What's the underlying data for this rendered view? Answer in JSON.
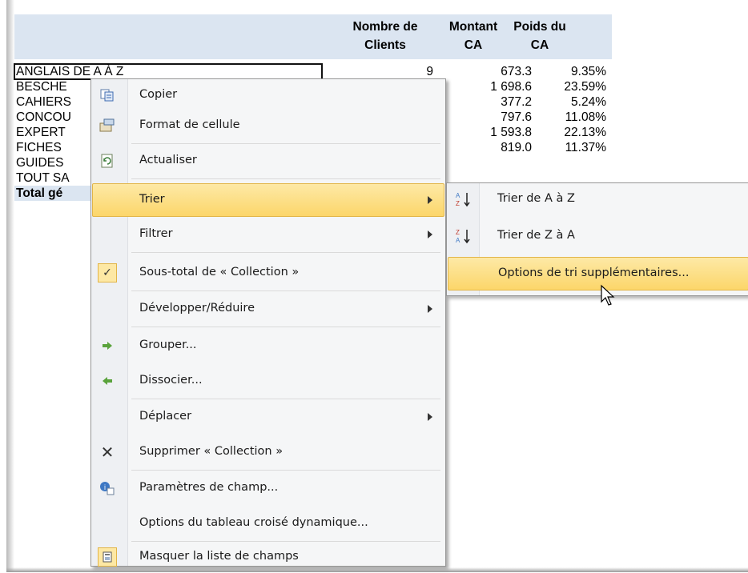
{
  "pivot": {
    "headers": {
      "clients": "Nombre de\nClients",
      "montant": "Montant\nCA",
      "poids": "Poids du\nCA"
    },
    "rows": [
      {
        "label": "ANGLAIS DE A À Z",
        "clients": "9",
        "montant": "673.3",
        "poids": "9.35%"
      },
      {
        "label": "BESCHE",
        "clients": "",
        "montant": "1 698.6",
        "poids": "23.59%"
      },
      {
        "label": "CAHIERS",
        "clients": "",
        "montant": "377.2",
        "poids": "5.24%"
      },
      {
        "label": "CONCOU",
        "clients": "",
        "montant": "797.6",
        "poids": "11.08%"
      },
      {
        "label": "EXPERT",
        "clients": "",
        "montant": "1 593.8",
        "poids": "22.13%"
      },
      {
        "label": "FICHES",
        "clients": "",
        "montant": "819.0",
        "poids": "11.37%"
      },
      {
        "label": "GUIDES",
        "clients": "",
        "montant": "",
        "poids": ""
      },
      {
        "label": "TOUT SA",
        "clients": "",
        "montant": "",
        "poids": ""
      },
      {
        "label": "Total gé",
        "clients": "",
        "montant": "",
        "poids": ""
      }
    ]
  },
  "menu": {
    "copy": "Copier",
    "format": "Format de cellule",
    "refresh": "Actualiser",
    "sort": "Trier",
    "filter": "Filtrer",
    "subtotal": "Sous-total de « Collection »",
    "expand": "Développer/Réduire",
    "group": "Grouper...",
    "ungroup": "Dissocier...",
    "move": "Déplacer",
    "remove": "Supprimer « Collection »",
    "field_settings": "Paramètres de champ...",
    "pivot_options": "Options du tableau croisé dynamique...",
    "hide_field_list": "Masquer la liste de champs",
    "checkmark": "✓",
    "remove_icon_glyph": "✕"
  },
  "submenu": {
    "sort_az": "Trier de A à Z",
    "sort_za": "Trier de Z à A",
    "more_options": "Options de tri supplémentaires..."
  },
  "colors": {
    "header_bg": "#dbe5f1",
    "highlight": "#fcd66a",
    "menu_bg": "#f5f6f7"
  }
}
